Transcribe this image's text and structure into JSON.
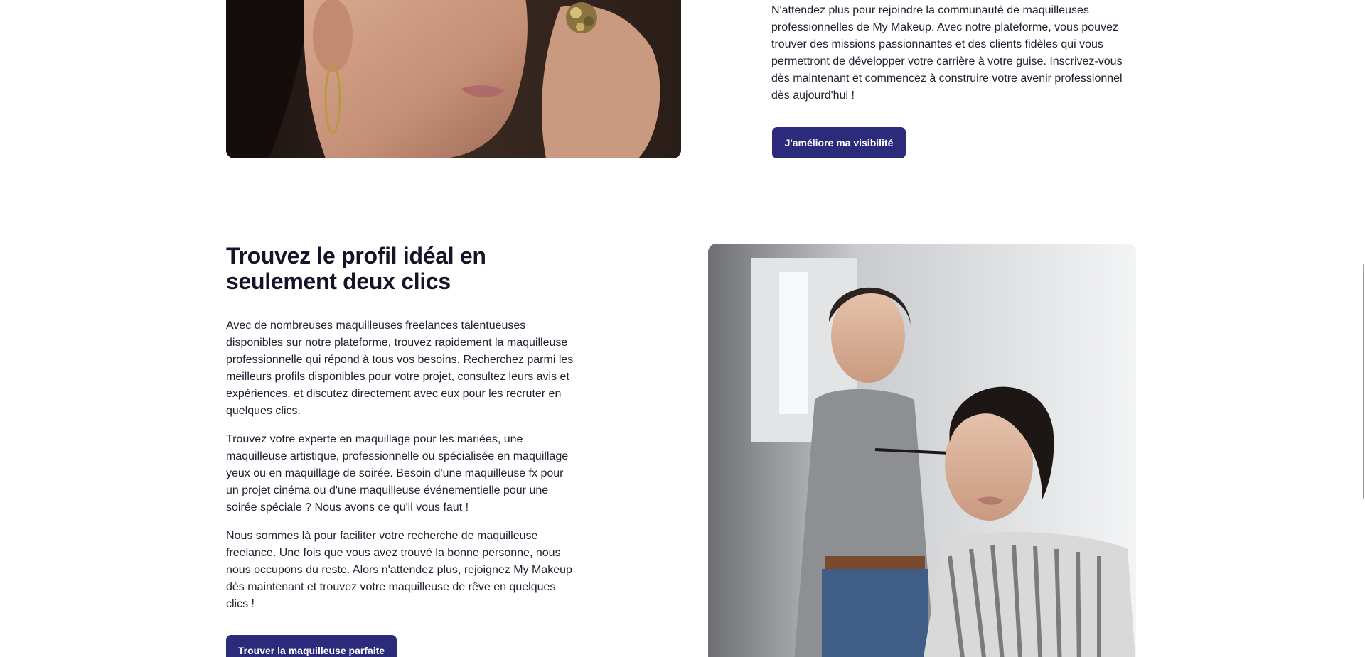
{
  "top_section": {
    "image_alt": "Gros plan d'une femme avec une bague dorée",
    "paragraph": "N'attendez plus pour rejoindre la communauté de maquilleuses professionnelles de My Makeup. Avec notre plateforme, vous pouvez trouver des missions passionnantes et des clients fidèles qui vous permettront de développer votre carrière à votre guise. Inscrivez-vous dès maintenant et commencez à construire votre avenir professionnel dès aujourd'hui !",
    "cta_label": "J'améliore ma visibilité"
  },
  "profile_section": {
    "title": "Trouvez le profil idéal en seulement deux clics",
    "paragraph_1": "Avec de nombreuses maquilleuses freelances talentueuses disponibles sur notre plateforme, trouvez rapidement la maquilleuse professionnelle qui répond à tous vos besoins. Recherchez parmi les meilleurs profils disponibles pour votre projet, consultez leurs avis et expériences, et discutez directement avec eux pour les recruter en quelques clics.",
    "paragraph_2": "Trouvez votre experte en maquillage pour les mariées, une maquilleuse artistique, professionnelle ou spécialisée en maquillage yeux ou en maquillage de soirée. Besoin d'une maquilleuse fx pour un projet cinéma ou d'une maquilleuse événementielle pour une soirée spéciale ? Nous avons ce qu'il vous faut !",
    "paragraph_3": "Nous sommes là pour faciliter votre recherche de maquilleuse freelance. Une fois que vous avez trouvé la bonne personne, nous nous occupons du reste. Alors n'attendez plus, rejoignez My Makeup dès maintenant et trouvez votre maquilleuse de rêve en quelques clics !",
    "cta_label": "Trouver la maquilleuse parfaite",
    "image_alt": "Maquilleuse appliquant du mascara sur une cliente"
  },
  "colors": {
    "button_bg": "#2c2a7a",
    "button_text": "#ffffff",
    "heading": "#141428",
    "body_text": "#1f1f2e"
  }
}
